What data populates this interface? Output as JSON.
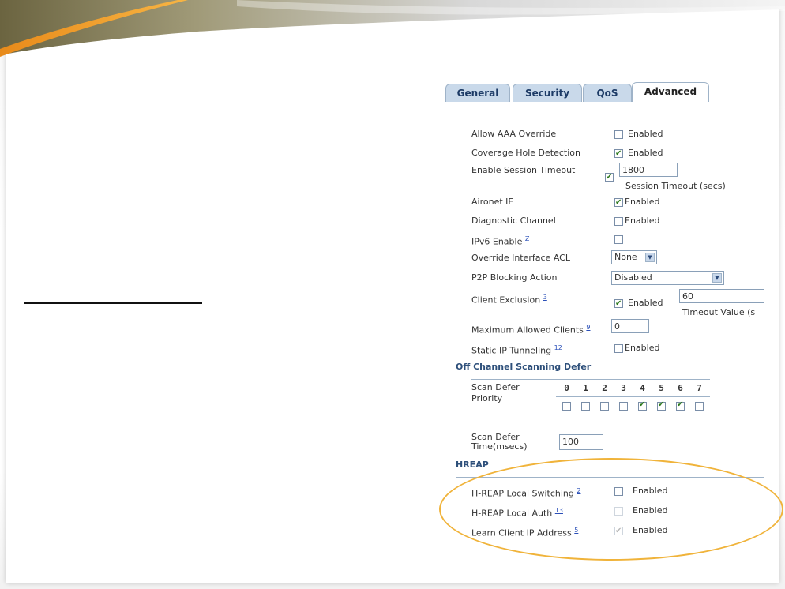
{
  "tabs": [
    {
      "label": "General"
    },
    {
      "label": "Security"
    },
    {
      "label": "QoS"
    },
    {
      "label": "Advanced"
    }
  ],
  "rows": {
    "aaa": {
      "label": "Allow AAA Override",
      "checked": false,
      "ctl_label": "Enabled"
    },
    "coverage": {
      "label": "Coverage Hole Detection",
      "checked": true,
      "ctl_label": "Enabled"
    },
    "session": {
      "label": "Enable Session Timeout",
      "checked": true,
      "value": "1800",
      "hint": "Session Timeout (secs)"
    },
    "aironet": {
      "label": "Aironet IE",
      "checked": true,
      "ctl_label": "Enabled"
    },
    "diag": {
      "label": "Diagnostic Channel",
      "checked": false,
      "ctl_label": "Enabled"
    },
    "ipv6": {
      "label": "IPv6 Enable",
      "sup": "Z",
      "checked": false
    },
    "override_acl": {
      "label": "Override Interface ACL",
      "value": "None"
    },
    "p2p": {
      "label": "P2P Blocking Action",
      "value": "Disabled"
    },
    "client_excl": {
      "label": "Client Exclusion",
      "sup": "3",
      "checked": true,
      "ctl_label": "Enabled",
      "value": "60",
      "hint": "Timeout Value (s"
    },
    "max_clients": {
      "label": "Maximum Allowed Clients",
      "sup": "9",
      "value": "0"
    },
    "static_ip": {
      "label": "Static IP Tunneling",
      "sup": "12",
      "checked": false,
      "ctl_label": "Enabled"
    }
  },
  "off_channel": {
    "title": "Off Channel Scanning Defer",
    "priority_label_line1": "Scan Defer",
    "priority_label_line2": "Priority",
    "priorities": [
      "0",
      "1",
      "2",
      "3",
      "4",
      "5",
      "6",
      "7"
    ],
    "priority_checked": [
      false,
      false,
      false,
      false,
      true,
      true,
      true,
      false
    ],
    "time_label_line1": "Scan Defer",
    "time_label_line2": "Time(msecs)",
    "time_value": "100"
  },
  "hreap": {
    "title": "HREAP",
    "local_switching": {
      "label": "H-REAP Local Switching",
      "sup": "2",
      "checked": false,
      "ctl_label": "Enabled"
    },
    "local_auth": {
      "label": "H-REAP Local Auth",
      "sup": "13",
      "checked": false,
      "disabled": true,
      "ctl_label": "Enabled"
    },
    "learn_ip": {
      "label": "Learn Client IP Address",
      "sup": "5",
      "checked": true,
      "disabled": true,
      "ctl_label": "Enabled"
    }
  },
  "colors": {
    "highlight_ellipse": "#f0b33a",
    "tab_bg": "#c9d9ea",
    "section_title": "#2d4f7a"
  }
}
